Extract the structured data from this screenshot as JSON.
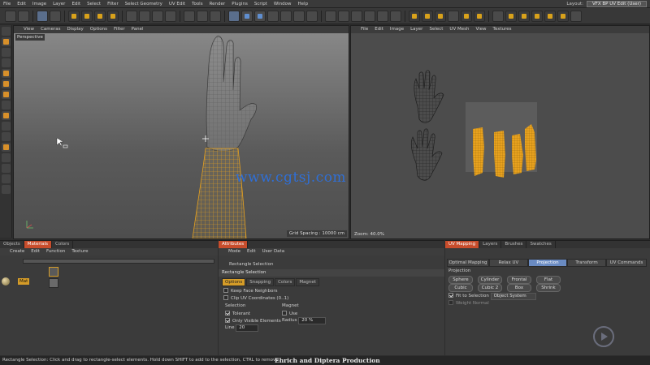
{
  "menubar": {
    "items": [
      "File",
      "Edit",
      "Image",
      "Layer",
      "Edit",
      "Select",
      "Filter",
      "Select Geometry",
      "UV Edit",
      "Tools",
      "Render",
      "Plugins",
      "Script",
      "Window",
      "Help"
    ],
    "layout_label": "Layout:",
    "layout_value": "VFX BP UV Edit (User)"
  },
  "viewport": {
    "menu": [
      "View",
      "Cameras",
      "Display",
      "Options",
      "Filter",
      "Panel"
    ],
    "label": "Perspective",
    "grid_spacing": "Grid Spacing : 10000 cm"
  },
  "uv_view": {
    "menu": [
      "File",
      "Edit",
      "Image",
      "Layer",
      "Select",
      "UV Mesh",
      "View",
      "Textures"
    ],
    "zoom": "Zoom: 40.0%"
  },
  "watermark": "www.cgtsj.com",
  "objects_panel": {
    "tabs": [
      "Objects",
      "Materials",
      "Colors"
    ],
    "active_tab": "Materials",
    "menu": [
      "Create",
      "Edit",
      "Function",
      "Texture"
    ],
    "material_name": "Mat"
  },
  "attributes_panel": {
    "tab": "Attributes",
    "menu": [
      "Mode",
      "Edit",
      "User Data"
    ],
    "tool_title": "Rectangle Selection",
    "section_title": "Rectangle Selection",
    "subtabs": [
      "Options",
      "Snapping",
      "Colors",
      "Magnet"
    ],
    "active_subtab": "Options",
    "keep_face_neighbors": "Keep Face Neighbors",
    "clip_uv": "Clip UV Coordinates (0..1)",
    "selection_header": "Selection",
    "tolerant": "Tolerant",
    "only_visible": "Only Visible Elements",
    "line_label": "Line",
    "line_value": "20",
    "magnet_header": "Magnet",
    "use_label": "Use",
    "radius_label": "Radius",
    "radius_value": "20 %"
  },
  "uv_mapping_panel": {
    "tabs": [
      "UV Mapping",
      "Layers",
      "Brushes",
      "Swatches"
    ],
    "active_tab": "UV Mapping",
    "subtabs": [
      "Optimal Mapping",
      "Relax UV",
      "Projection",
      "Transform",
      "UV Commands"
    ],
    "active_subtab": "Projection",
    "projection_header": "Projection",
    "buttons_row1": [
      "Sphere",
      "Cylinder",
      "Frontal",
      "Flat"
    ],
    "buttons_row2": [
      "Cubic",
      "Cubic 2",
      "Box",
      "Shrink"
    ],
    "fit_to_selection": "Fit to Selection",
    "fit_value": "Object System",
    "weight_normal": "Weight Normal"
  },
  "status": {
    "text": "Rectangle Selection: Click and drag to rectangle-select elements. Hold down SHIFT to add to the selection, CTRL to remove.",
    "credit": "Ehrich   and   Diptera  Production"
  },
  "colors": {
    "mesh_orange": "#e8a21e",
    "watermark_blue": "#2f6fd6",
    "active_tab_orange": "#c84d2c"
  }
}
